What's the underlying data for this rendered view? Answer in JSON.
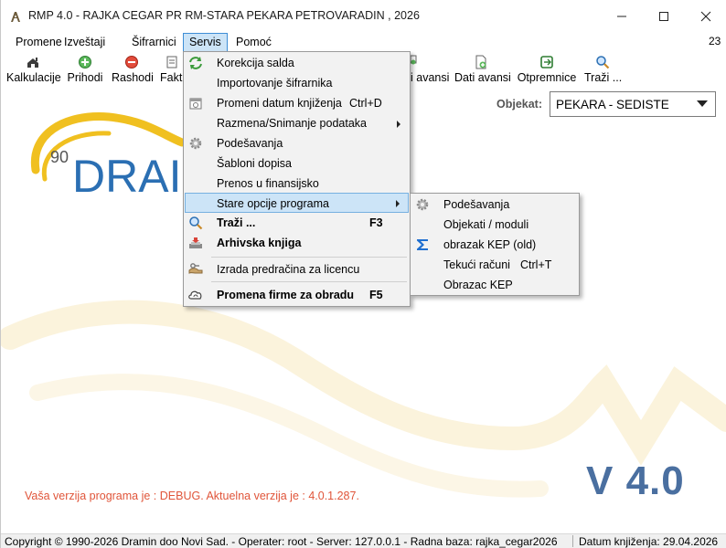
{
  "window": {
    "title": "RMP 4.0 - RAJKA CEGAR PR RM-STARA PEKARA PETROVARADIN , 2026",
    "minimize_icon": "minimize-icon",
    "maximize_icon": "maximize-icon",
    "close_icon": "close-icon"
  },
  "menubar": {
    "items": [
      "Promene",
      "Izveštaji",
      "Šifrarnici",
      "Servis",
      "Pomoć"
    ],
    "active": "Servis",
    "counter": "23"
  },
  "toolbar": {
    "items": [
      {
        "label": "Kalkulacije",
        "icon": "calculator-icon"
      },
      {
        "label": "Prihodi",
        "icon": "plus-circle-icon"
      },
      {
        "label": "Rashodi",
        "icon": "minus-circle-icon"
      },
      {
        "label": "Faktu",
        "icon": "invoice-icon"
      },
      {
        "label": "i avansi",
        "icon": "document-add-icon"
      },
      {
        "label": "Dati avansi",
        "icon": "document-add-icon"
      },
      {
        "label": "Otpremnice",
        "icon": "delivery-note-icon"
      },
      {
        "label": "Traži ...",
        "icon": "search-icon"
      }
    ]
  },
  "objekat": {
    "label": "Objekat:",
    "value": "PEKARA - SEDISTE"
  },
  "logo": {
    "badge": "90",
    "text": "DRAI"
  },
  "servis_menu": {
    "items": [
      {
        "label": "Korekcija salda",
        "icon": "refresh-arrows-icon",
        "shortcut": "",
        "bold": false
      },
      {
        "label": "Importovanje šifrarnika",
        "icon": "",
        "shortcut": "",
        "bold": false
      },
      {
        "label": "Promeni datum knjiženja",
        "icon": "calendar-icon",
        "shortcut": "Ctrl+D",
        "bold": false
      },
      {
        "label": "Razmena/Snimanje podataka",
        "icon": "",
        "shortcut": "",
        "bold": false,
        "submenu": true
      },
      {
        "label": "Podešavanja",
        "icon": "gear-icon",
        "shortcut": "",
        "bold": false
      },
      {
        "label": "Šabloni dopisa",
        "icon": "",
        "shortcut": "",
        "bold": false
      },
      {
        "label": "Prenos u finansijsko",
        "icon": "",
        "shortcut": "",
        "bold": false
      },
      {
        "label": "Stare opcije programa",
        "icon": "",
        "shortcut": "",
        "bold": false,
        "submenu": true,
        "highlighted": true
      },
      {
        "label": "Traži ...",
        "icon": "search-icon",
        "shortcut": "F3",
        "bold": true
      },
      {
        "label": "Arhivska knjiga",
        "icon": "archive-icon",
        "shortcut": "",
        "bold": true
      },
      {
        "label": "Izrada predračina za licencu",
        "icon": "key-hand-icon",
        "shortcut": "",
        "bold": false
      },
      {
        "label": "Promena firme za obradu",
        "icon": "cloud-sync-icon",
        "shortcut": "F5",
        "bold": true
      }
    ]
  },
  "stare_submenu": {
    "items": [
      {
        "label": "Podešavanja",
        "icon": "gear-icon",
        "shortcut": ""
      },
      {
        "label": "Objekati / moduli",
        "icon": "",
        "shortcut": ""
      },
      {
        "label": "obrazak KEP (old)",
        "icon": "sigma-icon",
        "shortcut": ""
      },
      {
        "label": "Tekući računi",
        "icon": "",
        "shortcut": "Ctrl+T"
      },
      {
        "label": "Obrazac KEP",
        "icon": "",
        "shortcut": ""
      }
    ]
  },
  "version": {
    "big": "V 4.0",
    "info": "Vaša verzija programa je : DEBUG. Aktuelna verzija je : 4.0.1.287."
  },
  "statusbar": {
    "copyright": "Copyright © 1990-2026 Dramin doo Novi Sad. - Operater: root - Server: 127.0.0.1 - Radna baza: rajka_cegar2026",
    "date": "Datum knjiženja: 29.04.2026"
  },
  "colors": {
    "menu_highlight": "#cce4f7",
    "version_blue": "#4a6fa0",
    "version_info_red": "#e0553a",
    "logo_yellow": "#f0c020",
    "logo_blue": "#2b6fb3"
  }
}
